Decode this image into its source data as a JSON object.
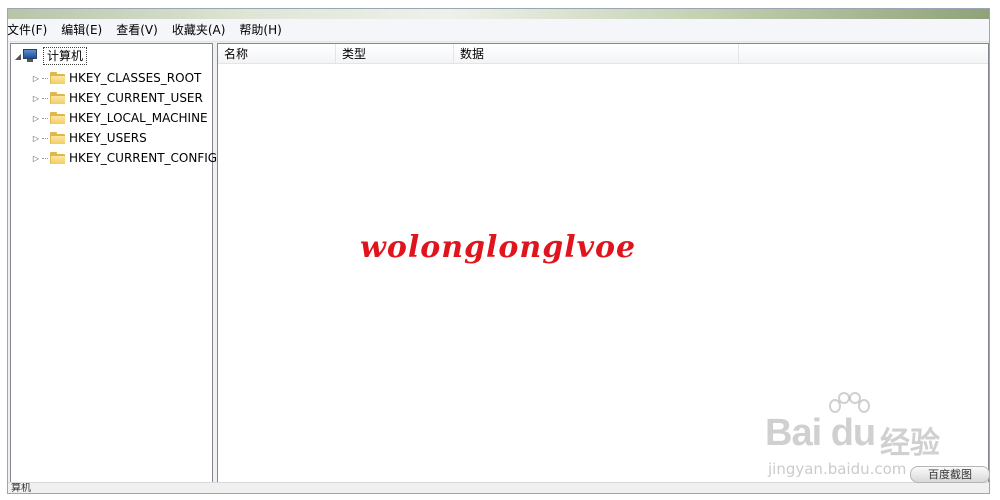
{
  "menu": [
    "文件(F)",
    "编辑(E)",
    "查看(V)",
    "收藏夹(A)",
    "帮助(H)"
  ],
  "tree": {
    "root_label": "计算机",
    "root_expander": "◢",
    "items": [
      {
        "label": "HKEY_CLASSES_ROOT"
      },
      {
        "label": "HKEY_CURRENT_USER"
      },
      {
        "label": "HKEY_LOCAL_MACHINE"
      },
      {
        "label": "HKEY_USERS"
      },
      {
        "label": "HKEY_CURRENT_CONFIG"
      }
    ],
    "collapsed_glyph": "▷"
  },
  "list": {
    "columns": [
      "名称",
      "类型",
      "数据"
    ]
  },
  "overlay_text": "wolonglonglvoe",
  "status": {
    "text": "算机"
  },
  "watermark": {
    "logo": "Bai du",
    "cn": "经验",
    "url": "jingyan.baidu.com",
    "capture": "百度截图"
  },
  "colors": {
    "overlay": "#e0141c",
    "folder": "#e2b64a"
  }
}
